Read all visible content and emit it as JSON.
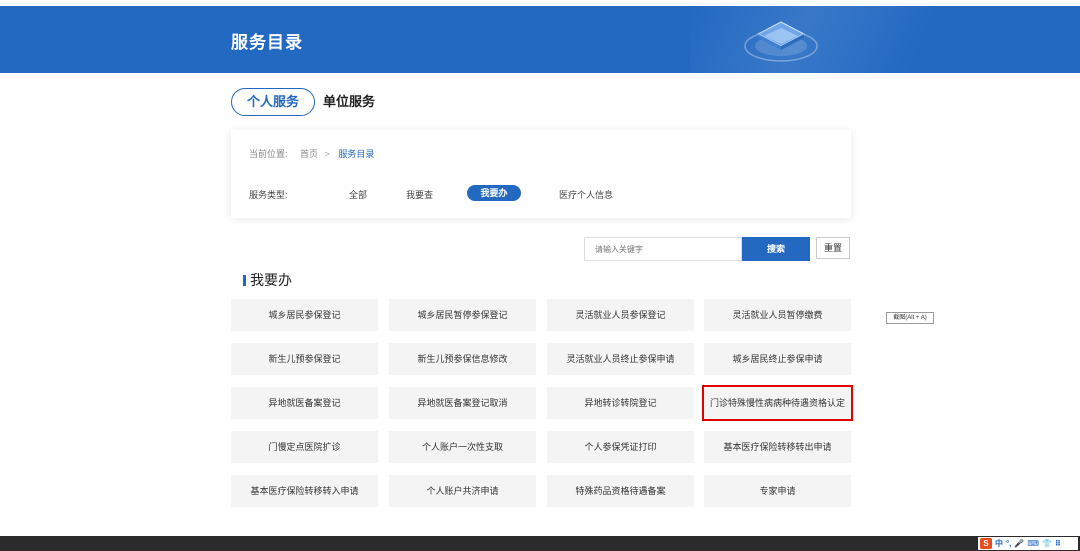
{
  "header": {
    "title": "服务目录",
    "logo_icon": "layers-stack-icon"
  },
  "tabs": [
    {
      "label": "个人服务",
      "active": true
    },
    {
      "label": "单位服务",
      "active": false
    }
  ],
  "breadcrumb": {
    "prefix": "当前位置:",
    "home": "首页",
    "separator": ">",
    "current": "服务目录"
  },
  "service_types": {
    "label": "服务类型:",
    "options": [
      {
        "label": "全部",
        "active": false
      },
      {
        "label": "我要查",
        "active": false
      },
      {
        "label": "我要办",
        "active": true
      },
      {
        "label": "医疗个人信息",
        "active": false
      }
    ]
  },
  "search": {
    "placeholder": "请输入关键字",
    "button_label": "搜索",
    "reset_label": "重置"
  },
  "section": {
    "title": "我要办"
  },
  "services": [
    [
      "城乡居民参保登记",
      "城乡居民暂停参保登记",
      "灵活就业人员参保登记",
      "灵活就业人员暂停缴费"
    ],
    [
      "新生儿预参保登记",
      "新生儿预参保信息修改",
      "灵活就业人员终止参保申请",
      "城乡居民终止参保申请"
    ],
    [
      "异地就医备案登记",
      "异地就医备案登记取消",
      "异地转诊转院登记",
      "门诊特殊慢性病病种待遇资格认定"
    ],
    [
      "门慢定点医院扩诊",
      "个人账户一次性支取",
      "个人参保凭证打印",
      "基本医疗保险转移转出申请"
    ],
    [
      "基本医疗保险转移转入申请",
      "个人账户共济申请",
      "特殊药品资格待遇备案",
      "专家申请"
    ]
  ],
  "highlighted_service": "门诊特殊慢性病病种待遇资格认定",
  "tooltip": "截图(Alt + A)",
  "colors": {
    "primary": "#2369c2",
    "highlight_border": "#e00000",
    "cell_bg": "#f4f4f4",
    "footer": "#2b2b2b"
  },
  "ime_toolbar": {
    "logo": "S",
    "items": [
      "中",
      "°,",
      "🎤",
      "⌨",
      "👕",
      "⠿"
    ]
  }
}
